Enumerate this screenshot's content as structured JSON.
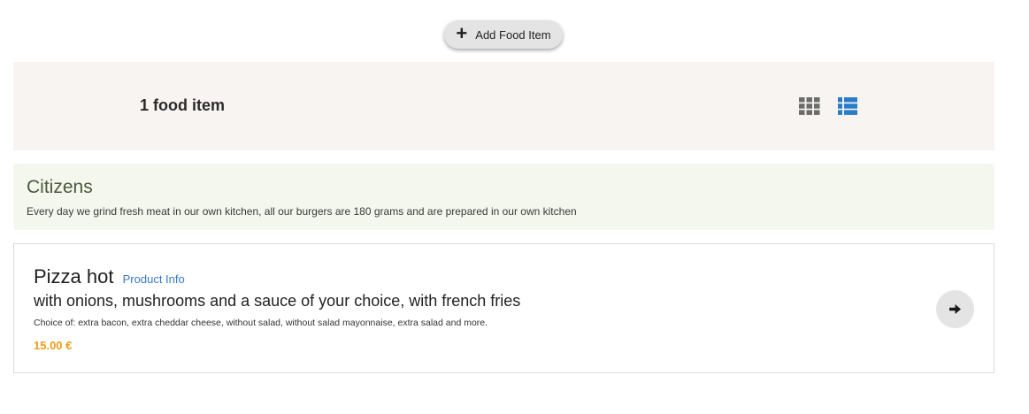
{
  "header": {
    "add_button_label": "Add Food Item",
    "add_icon": "plus-icon"
  },
  "toolbar": {
    "item_count": "1 food item",
    "grid_view_icon": "grid-view-icon",
    "list_view_icon": "list-view-icon",
    "active_view": "list",
    "inactive_color": "#6b6b6b",
    "active_color": "#2a7bc8"
  },
  "category": {
    "title": "Citizens",
    "description": "Every day we grind fresh meat in our own kitchen, all our burgers are 180 grams and are prepared in our own kitchen"
  },
  "products": [
    {
      "name": "Pizza hot",
      "info_link": "Product Info",
      "subtitle": "with onions, mushrooms and a sauce of your choice, with french fries",
      "choices": "Choice of: extra bacon, extra cheddar cheese, without salad, without salad mayonnaise, extra salad and more.",
      "price": "15.00 €",
      "price_color": "#f19a1a",
      "action_icon": "arrow-right-icon"
    }
  ]
}
